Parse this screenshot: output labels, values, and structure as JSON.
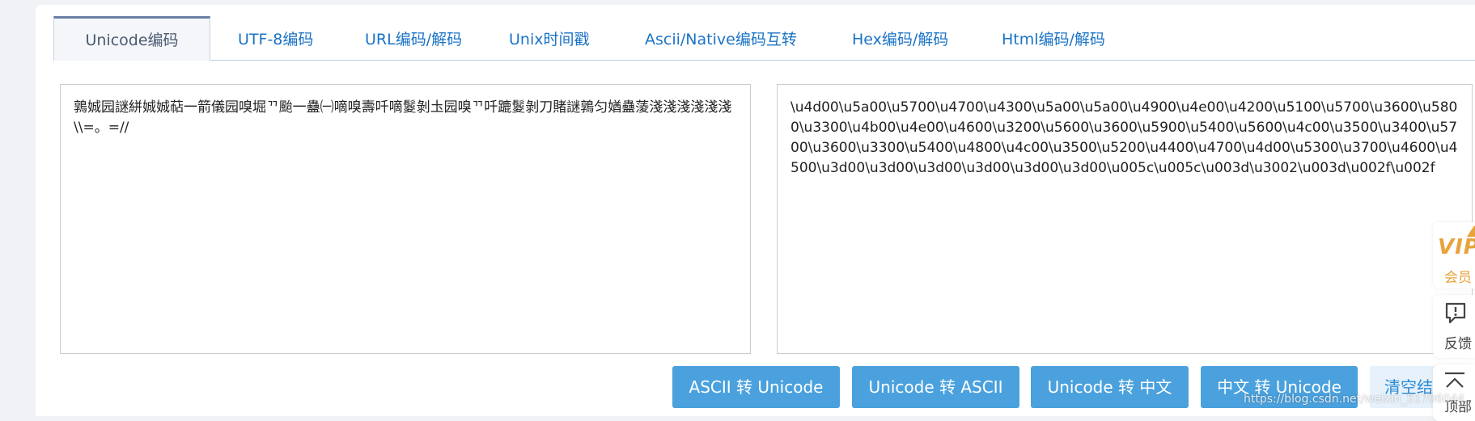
{
  "tabs": [
    {
      "label": "Unicode编码",
      "active": true
    },
    {
      "label": "UTF-8编码"
    },
    {
      "label": "URL编码/解码"
    },
    {
      "label": "Unix时间戳"
    },
    {
      "label": "Ascii/Native编码互转"
    },
    {
      "label": "Hex编码/解码"
    },
    {
      "label": "Html编码/解码"
    }
  ],
  "input": {
    "value": "鶉娍园謎絣娍娍萜一箭儀园嗅堀ᄁ颱一蠱㈠嘀嗅壽吀嘀鬉剝圡园嗅ᄁ吀蹗鬉剝刀賭謎鶉匀媨蠱蔆淺淺淺淺淺淺\\\\=。=//"
  },
  "output": {
    "value": "\\u4d00\\u5a00\\u5700\\u4700\\u4300\\u5a00\\u5a00\\u4900\\u4e00\\u4200\\u5100\\u5700\\u3600\\u5800\\u3300\\u4b00\\u4e00\\u4600\\u3200\\u5600\\u3600\\u5900\\u5400\\u5600\\u4c00\\u3500\\u3400\\u5700\\u3600\\u3300\\u5400\\u4800\\u4c00\\u3500\\u5200\\u4400\\u4700\\u4d00\\u5300\\u3700\\u4600\\u4500\\u3d00\\u3d00\\u3d00\\u3d00\\u3d00\\u3d00\\u005c\\u005c\\u003d\\u3002\\u003d\\u002f\\u002f"
  },
  "buttons": {
    "ascii_to_unicode": "ASCII 转 Unicode",
    "unicode_to_ascii": "Unicode 转 ASCII",
    "unicode_to_chinese": "Unicode 转 中文",
    "chinese_to_unicode": "中文 转 Unicode",
    "clear": "清空结"
  },
  "sidebar": {
    "vip_logo": "VIP",
    "vip_label": "会员",
    "feedback_label": "反馈",
    "top_label": "顶部"
  },
  "watermark": "https://blog.csdn.net/weixin_51706044",
  "colors": {
    "link": "#1b73c6",
    "button": "#4aa1dd",
    "vip": "#e8a33d"
  }
}
